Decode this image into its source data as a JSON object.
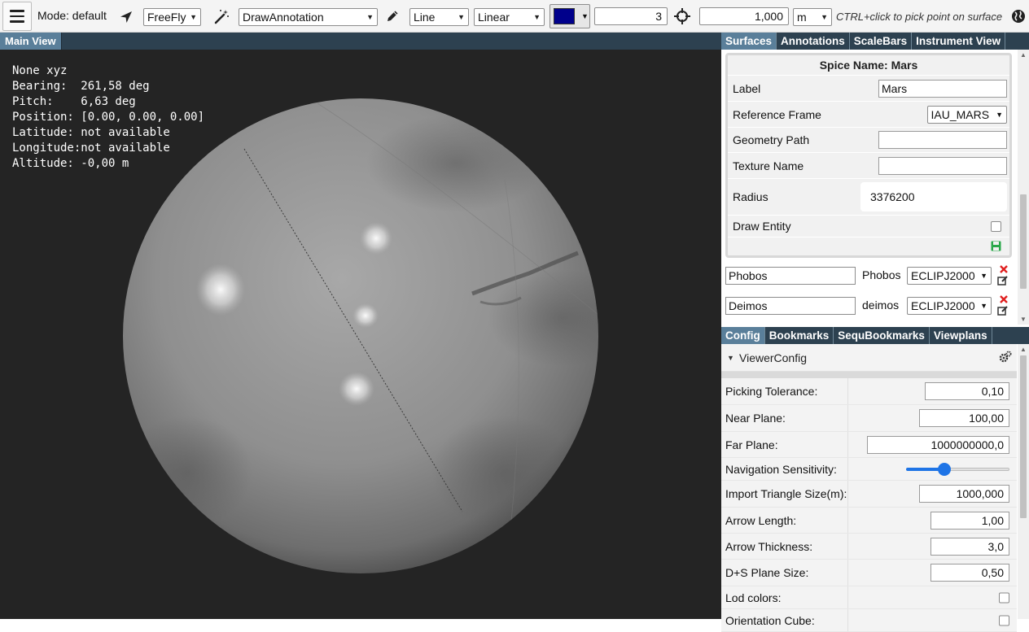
{
  "toolbar": {
    "mode_label": "Mode: default",
    "camera_mode": "FreeFly",
    "tool": "DrawAnnotation",
    "line_type": "Line",
    "interpolation": "Linear",
    "color": "#00008b",
    "thickness": "3",
    "distance": "1,000",
    "unit": "m",
    "hint": "CTRL+click to pick point on surface",
    "icons": [
      "menu-icon",
      "navigation-arrow-icon",
      "magic-wand-icon",
      "pencil-icon",
      "crosshair-icon",
      "globe-icon"
    ]
  },
  "main_view": {
    "tab_label": "Main View",
    "overlay_lines": [
      "None xyz",
      "Bearing:  261,58 deg",
      "Pitch:    6,63 deg",
      "Position: [0.00, 0.00, 0.00]",
      "Latitude: not available",
      "Longitude:not available",
      "Altitude: -0,00 m"
    ]
  },
  "top_tabs": [
    "Surfaces",
    "Annotations",
    "ScaleBars",
    "Instrument View"
  ],
  "spice": {
    "title": "Spice Name: Mars",
    "label_label": "Label",
    "label_value": "Mars",
    "ref_frame_label": "Reference Frame",
    "ref_frame_value": "IAU_MARS",
    "geometry_label": "Geometry Path",
    "geometry_value": "",
    "texture_label": "Texture Name",
    "texture_value": "",
    "radius_label": "Radius",
    "radius_value": "3376200",
    "draw_entity_label": "Draw Entity"
  },
  "bodies": [
    {
      "name": "Phobos",
      "id": "Phobos",
      "frame": "ECLIPJ2000"
    },
    {
      "name": "Deimos",
      "id": "deimos",
      "frame": "ECLIPJ2000"
    }
  ],
  "bottom_tabs": [
    "Config",
    "Bookmarks",
    "SequBookmarks",
    "Viewplans"
  ],
  "viewer_config": {
    "title": "ViewerConfig",
    "picking_label": "Picking Tolerance:",
    "picking_value": "0,10",
    "near_label": "Near Plane:",
    "near_value": "100,00",
    "far_label": "Far Plane:",
    "far_value": "1000000000,0",
    "nav_label": "Navigation Sensitivity:",
    "nav_value": 0.35,
    "import_label": "Import Triangle Size(m):",
    "import_value": "1000,000",
    "arrow_len_label": "Arrow Length:",
    "arrow_len_value": "1,00",
    "arrow_thick_label": "Arrow Thickness:",
    "arrow_thick_value": "3,0",
    "plane_label": "D+S Plane Size:",
    "plane_value": "0,50",
    "lod_label": "Lod colors:",
    "cube_label": "Orientation Cube:"
  }
}
